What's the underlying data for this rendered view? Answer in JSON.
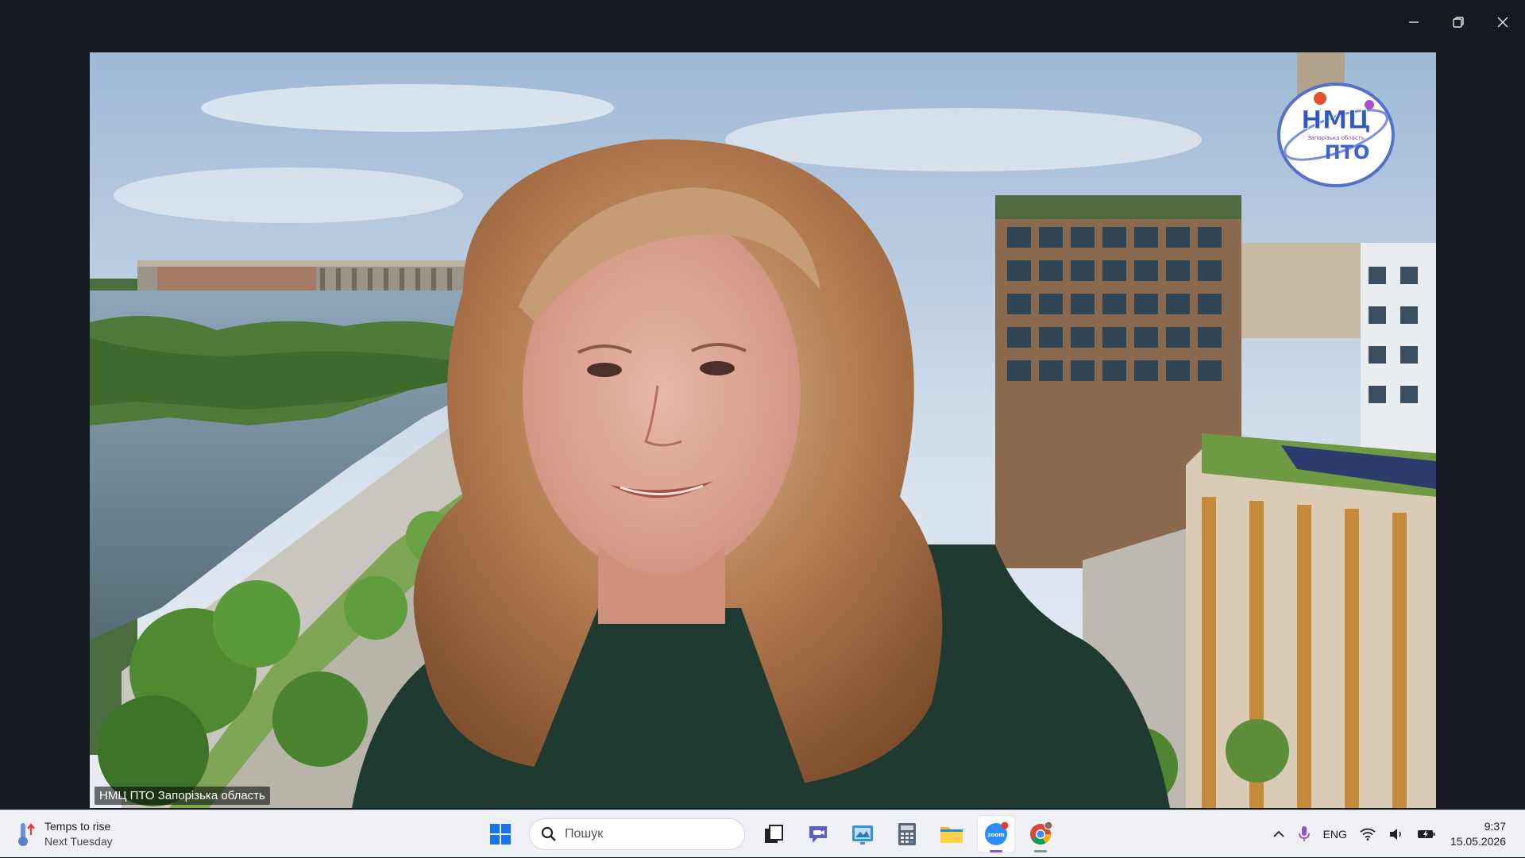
{
  "window": {
    "controls": {
      "minimize_icon": "minimize-icon",
      "restore_icon": "restore-icon",
      "close_icon": "close-icon"
    }
  },
  "video": {
    "participant_name": "НМЦ ПТО Запорізька область",
    "logo": {
      "text_top": "НМЦ",
      "text_bottom": "ПТО",
      "arc_text": "Запорізька область"
    }
  },
  "taskbar": {
    "weather": {
      "title": "Temps to rise",
      "subtitle": "Next Tuesday"
    },
    "search": {
      "placeholder": "Пошук"
    },
    "apps": [
      {
        "name": "start",
        "icon": "windows-logo-icon"
      },
      {
        "name": "task-view",
        "icon": "task-view-icon"
      },
      {
        "name": "teams-chat",
        "icon": "chat-icon"
      },
      {
        "name": "widgets",
        "icon": "widgets-icon"
      },
      {
        "name": "calculator",
        "icon": "calculator-icon"
      },
      {
        "name": "file-explorer",
        "icon": "folder-icon"
      },
      {
        "name": "zoom",
        "icon": "zoom-icon",
        "active": true,
        "badge_label": "zoom"
      },
      {
        "name": "chrome",
        "icon": "chrome-icon"
      }
    ],
    "tray": {
      "language": "ENG",
      "time": "9:37",
      "date": "15.05.2026"
    }
  },
  "colors": {
    "zoom_accent": "#2d8cff",
    "active_indicator": "#9a4fd3",
    "taskbar_bg": "#eef0f5",
    "window_bg": "#161b22"
  }
}
